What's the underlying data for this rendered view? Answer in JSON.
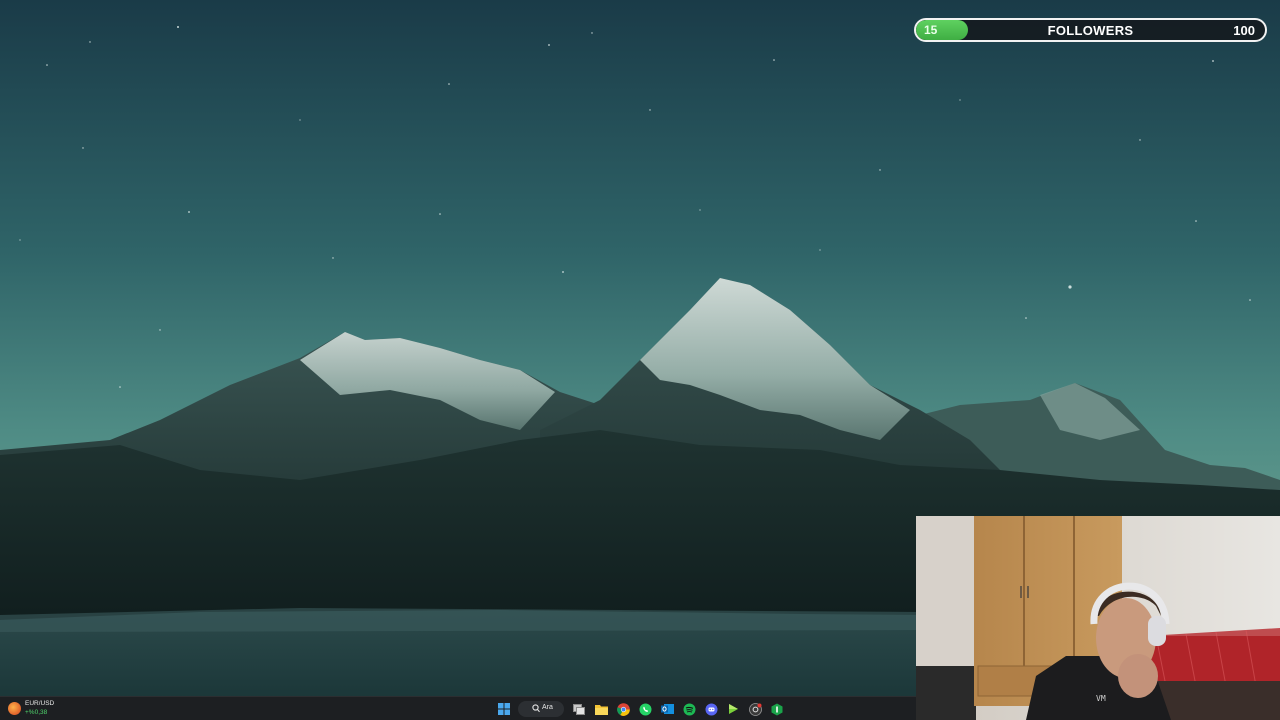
{
  "follower_goal": {
    "title": "FOLLOWERS",
    "current": "15",
    "target": "100",
    "progress_fraction": 0.15,
    "fill_color": "#4bbf4f"
  },
  "taskbar": {
    "ticker": {
      "pair": "EUR/USD",
      "change": "+%0,38",
      "change_color": "#4fd36b"
    },
    "search_label": "Ara",
    "icons": [
      "windows-start-icon",
      "search-icon",
      "task-view-icon",
      "file-explorer-icon",
      "chrome-icon",
      "whatsapp-icon",
      "outlook-icon",
      "spotify-icon",
      "discord-icon",
      "media-player-icon",
      "chrome-alt-icon",
      "app-icon"
    ]
  },
  "webcam": {
    "content": "streamer-camera-feed"
  }
}
